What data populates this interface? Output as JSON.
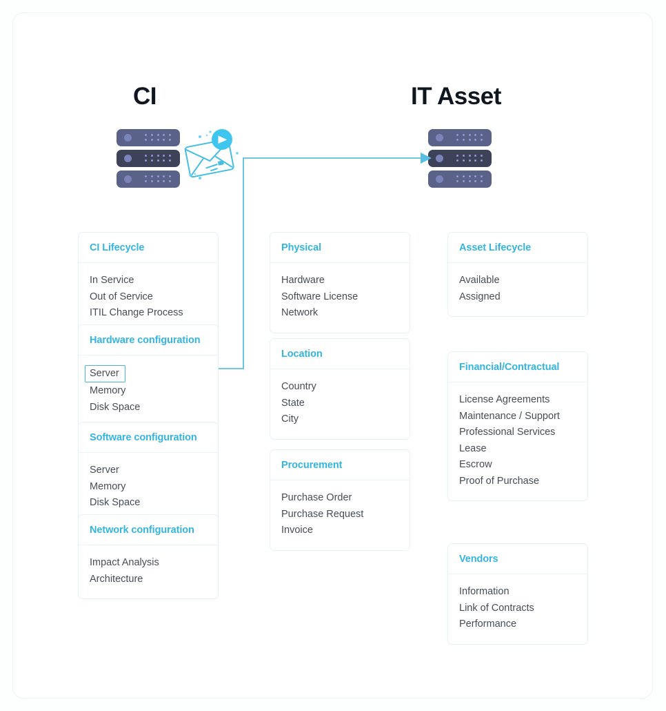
{
  "diagram": {
    "sections": [
      {
        "id": "ci",
        "title": "CI",
        "icon": "server-stack-icon"
      },
      {
        "id": "it_asset",
        "title": "IT Asset",
        "icon": "server-stack-icon"
      }
    ],
    "decorative_icons": [
      {
        "name": "envelope-send-icon"
      }
    ],
    "connector": {
      "name": "server-to-it-asset-connector",
      "from_label": "Server",
      "from_card": "Hardware configuration",
      "to": "IT Asset server stack",
      "color": "#59bfe0",
      "arrow": "right-arrowhead"
    },
    "colors": {
      "header_accent": "#33b5e0",
      "body_text": "#474c55",
      "title_text": "#10161f",
      "card_border": "#e6f0f5",
      "frame_border": "#eaf3f7",
      "connector": "#59bfe0",
      "highlight_border": "#4ab6dd",
      "server_light": "#5a628a",
      "server_dark": "#3d4259",
      "server_led": "#7a84b8"
    },
    "columns": [
      {
        "id": "col-left",
        "cards": [
          {
            "header": "CI Lifecycle",
            "items": [
              "In Service",
              "Out of Service",
              "ITIL Change Process"
            ]
          },
          {
            "header": "Hardware configuration",
            "items": [
              "Server",
              "Memory",
              "Disk Space"
            ],
            "highlight_item": "Server"
          },
          {
            "header": "Software configuration",
            "items": [
              "Server",
              "Memory",
              "Disk Space"
            ]
          },
          {
            "header": "Network configuration",
            "items": [
              "Impact Analysis",
              "Architecture"
            ]
          }
        ]
      },
      {
        "id": "col-mid",
        "cards": [
          {
            "header": "Physical",
            "items": [
              "Hardware",
              "Software License",
              "Network"
            ]
          },
          {
            "header": "Location",
            "items": [
              "Country",
              "State",
              "City"
            ]
          },
          {
            "header": "Procurement",
            "items": [
              "Purchase Order",
              "Purchase Request",
              "Invoice"
            ]
          }
        ]
      },
      {
        "id": "col-right",
        "cards": [
          {
            "header": "Asset Lifecycle",
            "items": [
              "Available",
              "Assigned"
            ]
          },
          {
            "header": "Financial/Contractual",
            "items": [
              "License Agreements",
              "Maintenance / Support",
              "Professional Services",
              "Lease",
              "Escrow",
              "Proof of Purchase"
            ]
          },
          {
            "header": "Vendors",
            "items": [
              "Information",
              "Link of Contracts",
              "Performance"
            ]
          }
        ]
      }
    ]
  }
}
